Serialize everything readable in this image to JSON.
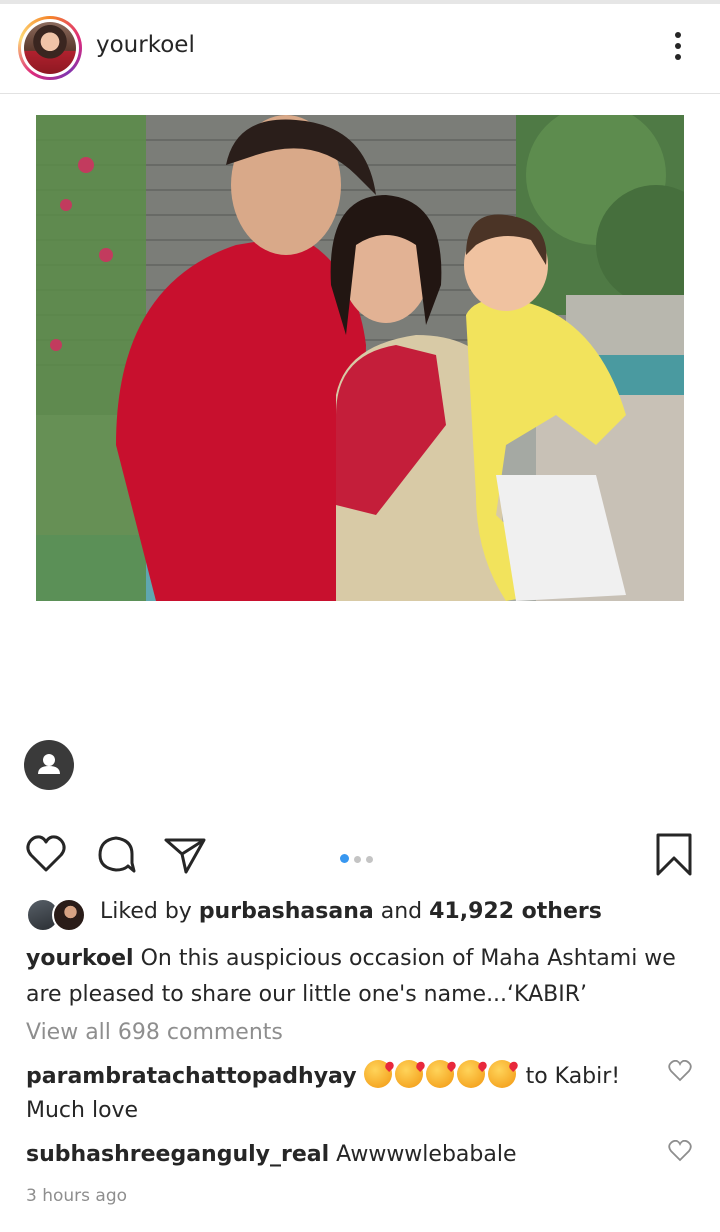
{
  "header": {
    "username": "yourkoel"
  },
  "post": {
    "carousel_index": 1,
    "carousel_count": 3
  },
  "likes": {
    "prefix": "Liked by",
    "liker": "purbashasana",
    "and": "and",
    "count_text": "41,922 others"
  },
  "caption": {
    "username": "yourkoel",
    "text": "On this auspicious occasion of Maha Ashtami we are pleased to share our little one's name...‘KABIR’"
  },
  "comments": {
    "view_all": "View all 698 comments",
    "items": [
      {
        "username": "parambratachattopadhyay",
        "text": "to Kabir! Much love",
        "emoji_count": 5
      },
      {
        "username": "subhashreeganguly_real",
        "text": "Awwwwlebabale"
      }
    ]
  },
  "timestamp": "3 hours ago",
  "icons": {
    "header_more": "more-vertical-icon",
    "like": "heart-icon",
    "comment": "comment-icon",
    "share": "share-icon",
    "save": "bookmark-icon",
    "user_tag": "user-tag-icon"
  },
  "colors": {
    "accent_blue": "#3897f0",
    "muted_gray": "#8e8e8e",
    "text": "#262626"
  }
}
